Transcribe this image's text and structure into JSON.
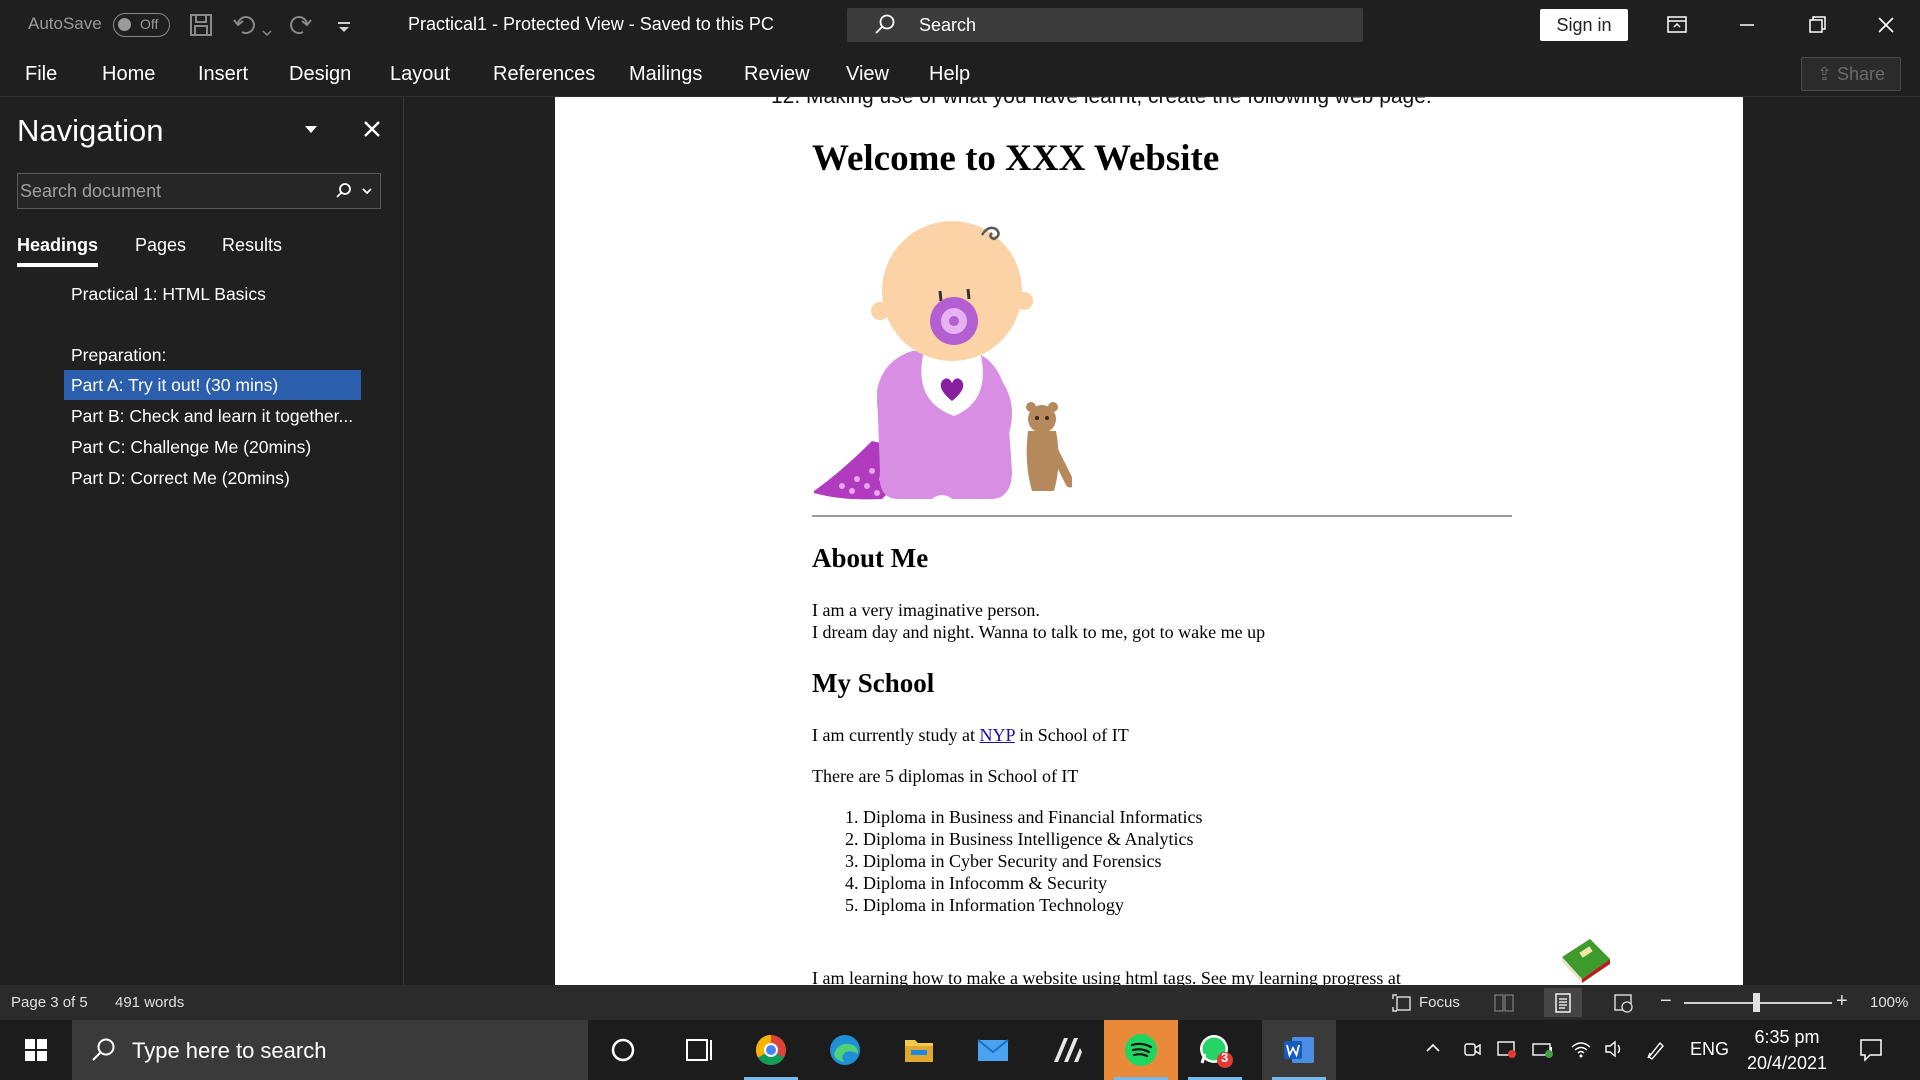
{
  "titlebar": {
    "autosave_label": "AutoSave",
    "autosave_state": "Off",
    "document_title": "Practical1  -  Protected View  -  Saved to this PC",
    "search_label": "Search",
    "signin_label": "Sign in"
  },
  "ribbon": {
    "tabs": [
      "File",
      "Home",
      "Insert",
      "Design",
      "Layout",
      "References",
      "Mailings",
      "Review",
      "View",
      "Help"
    ],
    "share_label": "Share"
  },
  "navigation": {
    "title": "Navigation",
    "search_placeholder": "Search document",
    "tabs": [
      "Headings",
      "Pages",
      "Results"
    ],
    "headings": [
      "Practical 1: HTML Basics",
      "Preparation:",
      "Part A: Try it out! (30 mins)",
      "Part B: Check and learn it together...",
      "Part C: Challenge Me (20mins)",
      "Part D: Correct Me (20mins)"
    ],
    "selected_index": 2
  },
  "document": {
    "cut_line": "12. Making use of what you have learnt, create the following web page:",
    "h1": "Welcome to XXX Website",
    "about_heading": "About Me",
    "about_line1": "I am a very imaginative person.",
    "about_line2": "I dream day and night. Wanna to talk to me, got to wake me up",
    "school_heading": "My School",
    "school_p1_before": "I am currently study at ",
    "school_p1_link": "NYP",
    "school_p1_after": " in School of IT",
    "school_p2": "There are 5 diplomas in School of IT",
    "diplomas": [
      "1. Diploma in Business and Financial Informatics",
      "2. Diploma in Business Intelligence & Analytics",
      "3. Diploma in Cyber Security and Forensics",
      "4. Diploma in Infocomm & Security",
      "5. Diploma in Information Technology"
    ],
    "learning_line": "I am learning how to make a website using html tags. See my learning progress at"
  },
  "statusbar": {
    "page": "Page 3 of 5",
    "words": "491 words",
    "focus_label": "Focus",
    "zoom": "100%"
  },
  "taskbar": {
    "search_placeholder": "Type here to search",
    "whatsapp_badge": "3",
    "language": "ENG",
    "time": "6:35 pm",
    "date": "20/4/2021"
  },
  "colors": {
    "selection": "#2b5fae",
    "link": "#1a0dab",
    "taskbar_active_indicator": "#76b9ed"
  }
}
